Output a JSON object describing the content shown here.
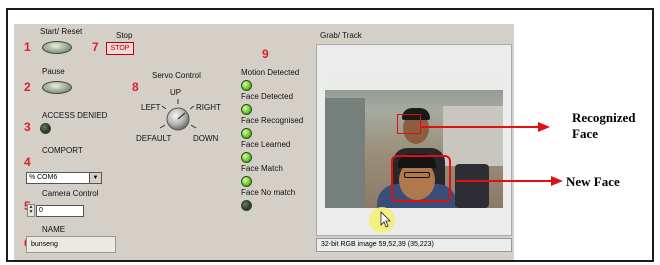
{
  "panel": {
    "start_reset": {
      "label": "Start/ Reset",
      "num": "1"
    },
    "stop": {
      "label": "Stop",
      "button": "STOP",
      "num": "7"
    },
    "pause": {
      "label": "Pause",
      "num": "2"
    },
    "access": {
      "label": "ACCESS DENIED",
      "num": "3"
    },
    "comport": {
      "label": "COMPORT",
      "value": "COM6",
      "prefix": "%",
      "num": "4"
    },
    "camera": {
      "label": "Camera Control",
      "value": "0",
      "num": "5"
    },
    "name": {
      "label": "NAME",
      "value": "bunseng",
      "num": "6"
    },
    "servo": {
      "label": "Servo Control",
      "num": "8",
      "up": "UP",
      "left": "LEFT",
      "right": "RIGHT",
      "default": "DEFAULT",
      "down": "DOWN"
    },
    "indicators": {
      "num": "9",
      "items": [
        {
          "label": "Motion Detected",
          "state": "on"
        },
        {
          "label": "Face Detected",
          "state": "on"
        },
        {
          "label": "Face Recognised",
          "state": "on"
        },
        {
          "label": "Face Learned",
          "state": "on"
        },
        {
          "label": "Face Match",
          "state": "on"
        },
        {
          "label": "Face No match",
          "state": "off"
        }
      ]
    },
    "grab": {
      "label": "Grab/ Track",
      "status": "32-bit RGB image 59,52,39    (35,223)"
    }
  },
  "annotations": {
    "recognized": "Recognized\nFace",
    "new_face": "New Face"
  },
  "colors": {
    "panel_bg": "#d4d0c8",
    "number_red": "#e02020",
    "led_on": "#6bc832",
    "led_off": "#2f3d28",
    "box_red": "#e01010"
  }
}
